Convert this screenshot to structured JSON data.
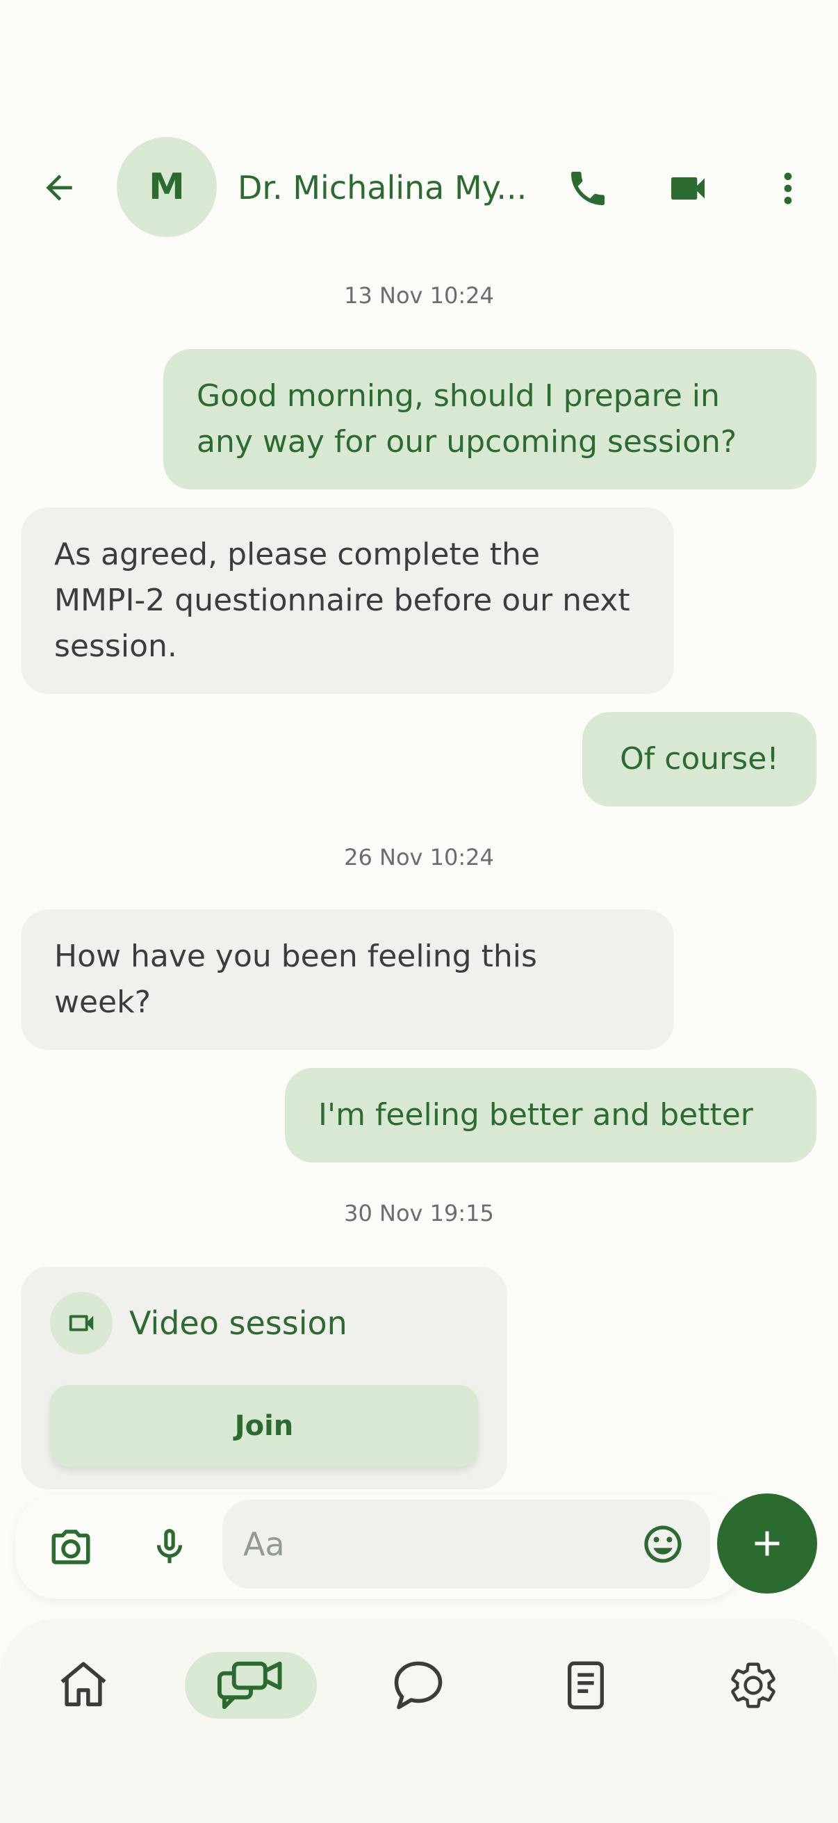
{
  "header": {
    "avatar_initial": "M",
    "contact_name": "Dr. Michalina My..."
  },
  "messages": {
    "ts1": "13 Nov 10:24",
    "m1": "Good morning, should I prepare in any way for our upcoming session?",
    "m2": "As agreed, please complete the MMPI-2 questionnaire before our next session.",
    "m3": "Of course!",
    "ts2": "26 Nov 10:24",
    "m4": "How have you been feeling this week?",
    "m5": "I'm feeling better and better",
    "ts3": "30 Nov 19:15"
  },
  "video_card": {
    "title": "Video session",
    "join_label": "Join"
  },
  "composer": {
    "placeholder": "Aa"
  },
  "colors": {
    "accent": "#2c6b2f",
    "bubble_out": "#d8e8d2",
    "bubble_in": "#f0f0ec",
    "background": "#fbfcf7"
  },
  "icons": {
    "back": "arrow-left-icon",
    "call": "phone-icon",
    "video": "video-camera-icon",
    "more": "more-vertical-icon",
    "camera": "camera-icon",
    "mic": "microphone-icon",
    "emoji": "emoji-icon",
    "add": "plus-icon",
    "nav": [
      "home-icon",
      "video-chat-icon",
      "chat-bubble-icon",
      "notes-icon",
      "settings-icon"
    ]
  }
}
